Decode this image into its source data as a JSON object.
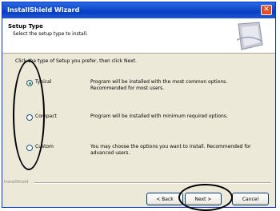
{
  "window": {
    "title": "InstallShield Wizard",
    "close_glyph": "✕"
  },
  "header": {
    "title": "Setup Type",
    "subtitle": "Select the setup type to install."
  },
  "prompt": "Click the type of Setup you prefer, then click Next.",
  "options": [
    {
      "label": "Typical",
      "description": "Program will be installed with the most common options. Recommended for most users.",
      "checked": true
    },
    {
      "label": "Compact",
      "description": "Program will be installed with minimum required options.",
      "checked": false
    },
    {
      "label": "Custom",
      "description": "You may choose the options you want to install. Recommended for advanced users.",
      "checked": false
    }
  ],
  "footer": {
    "brand": "InstallShield"
  },
  "buttons": {
    "back": "< Back",
    "next": "Next >",
    "cancel": "Cancel"
  },
  "colors": {
    "titlebar": "#0a3ec4",
    "close": "#e0502d",
    "dialog_bg": "#ece9d8",
    "radio_dot": "#21a121"
  },
  "icons": {
    "close": "close-icon",
    "header_art": "header-graphic"
  }
}
